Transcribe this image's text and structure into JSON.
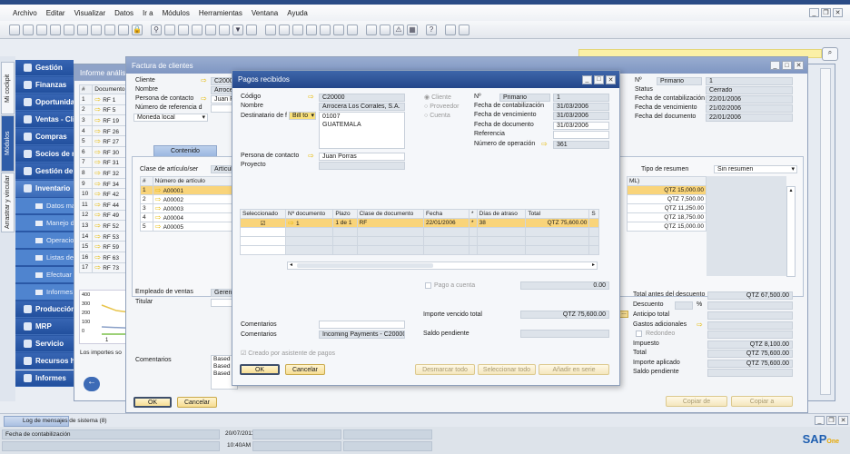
{
  "menu": [
    "Archivo",
    "Editar",
    "Visualizar",
    "Datos",
    "Ir a",
    "Módulos",
    "Herramientas",
    "Ventana",
    "Ayuda"
  ],
  "toolbar_icons": [
    "preview-icon",
    "print-icon",
    "email-icon",
    "sms-icon",
    "fax-icon",
    "excel-icon",
    "word-icon",
    "pdf-icon",
    "launch-icon",
    "lock-icon",
    "find-icon",
    "add-icon",
    "first-record-icon",
    "previous-record-icon",
    "next-record-icon",
    "last-record-icon",
    "filter-icon",
    "sort-icon",
    "base-document-icon",
    "target-document-icon",
    "layout-icon",
    "gross-profit-icon",
    "payment-means-icon",
    "volume-weight-icon",
    "journal-icon",
    "settings-icon",
    "transaction-journal-icon",
    "alert-icon",
    "calendar-icon",
    "help-icon",
    "message-icon",
    "widget-icon"
  ],
  "vtabs": [
    "Mi cockpit",
    "Módulos",
    "Arrastrar y vincular"
  ],
  "modules": [
    "Gestión",
    "Finanzas",
    "Oportunidades",
    "Ventas - Clientes",
    "Compras",
    "Socios de negocios",
    "Gestión de bancos",
    "Inventario"
  ],
  "inventory_sub": [
    "Datos maestros",
    "Manejo de números",
    "Operaciones",
    "Listas de precios",
    "Efectuar recuento",
    "Informes"
  ],
  "modules_after": [
    "Producción",
    "MRP",
    "Servicio",
    "Recursos humanos",
    "Informes"
  ],
  "report": {
    "title": "Informe análisis",
    "col_num": "#",
    "col_doc": "Documento",
    "rows": [
      [
        "1",
        "RF 1"
      ],
      [
        "2",
        "RF 5"
      ],
      [
        "3",
        "RF 19"
      ],
      [
        "4",
        "RF 26"
      ],
      [
        "5",
        "RF 27"
      ],
      [
        "6",
        "RF 30"
      ],
      [
        "7",
        "RF 31"
      ],
      [
        "8",
        "RF 32"
      ],
      [
        "9",
        "RF 34"
      ],
      [
        "10",
        "RF 42"
      ],
      [
        "11",
        "RF 44"
      ],
      [
        "12",
        "RF 49"
      ],
      [
        "13",
        "RF 52"
      ],
      [
        "14",
        "RF 53"
      ],
      [
        "15",
        "RF 59"
      ],
      [
        "16",
        "RF 63"
      ],
      [
        "17",
        "RF 73"
      ]
    ],
    "chart_ticks": [
      "400",
      "300",
      "200",
      "100",
      "0"
    ],
    "chart_x": "1",
    "note": "Los importes so"
  },
  "invoice": {
    "title": "Factura de clientes",
    "cliente_l": "Cliente",
    "cliente": "C20000",
    "nombre_l": "Nombre",
    "nombre": "Arrocera",
    "contacto_l": "Persona de contacto",
    "contacto": "Juan P",
    "ref_l": "Número de referencia d",
    "moneda": "Moneda local",
    "tab": "Contenido",
    "clase_l": "Clase de artículo/ser",
    "clase": "Artículo",
    "col_num": "#",
    "col_item": "Número de artículo",
    "items": [
      [
        "1",
        "A00001"
      ],
      [
        "2",
        "A00002"
      ],
      [
        "3",
        "A00003"
      ],
      [
        "4",
        "A00004"
      ],
      [
        "5",
        "A00005"
      ]
    ],
    "col_total": "ML)",
    "totals": [
      "QTZ 15,000.00",
      "QTZ 7,500.00",
      "QTZ 11,250.00",
      "QTZ 18,750.00",
      "QTZ 15,000.00"
    ],
    "resumen_l": "Tipo de resumen",
    "resumen": "Sin resumen",
    "no_l": "Nº",
    "no_type": "Primario",
    "no": "1",
    "status_l": "Status",
    "status": "Cerrado",
    "fcont_l": "Fecha de contabilización",
    "fcont": "22/01/2006",
    "fvenc_l": "Fecha de vencimiento",
    "fvenc": "21/02/2006",
    "fdoc_l": "Fecha del documento",
    "fdoc": "22/01/2006",
    "empleado_l": "Empleado de ventas",
    "empleado": "Gerente",
    "titular_l": "Titular",
    "comentarios_l": "Comentarios",
    "comentarios": [
      "Based",
      "Based",
      "Based"
    ],
    "tad_l": "Total antes del descuento",
    "tad": "QTZ 67,500.00",
    "desc_l": "Descuento",
    "pct": "%",
    "anticipo_l": "Anticipo total",
    "gastos_l": "Gastos adicionales",
    "redondeo_l": "Redondeo",
    "impuesto_l": "Impuesto",
    "impuesto": "QTZ 8,100.00",
    "total_l": "Total",
    "total": "QTZ 75,600.00",
    "aplicado_l": "Importe aplicado",
    "aplicado": "QTZ 75,600.00",
    "saldo_l": "Saldo pendiente",
    "ok": "OK",
    "cancel": "Cancelar",
    "copy_from": "Copiar de",
    "copy_to": "Copiar a"
  },
  "payment": {
    "title": "Pagos recibidos",
    "codigo_l": "Código",
    "codigo": "C20000",
    "nombre_l": "Nombre",
    "nombre": "Arrocera Los Corrales, S.A.",
    "dest_l": "Destinatario de f",
    "dest": "Bill to",
    "address": [
      "01007",
      "GUATEMALA"
    ],
    "contacto_l": "Persona de contacto",
    "contacto": "Juan Porras",
    "proyecto_l": "Proyecto",
    "radios": [
      "Cliente",
      "Proveedor",
      "Cuenta"
    ],
    "no_l": "Nº",
    "no_type": "Primario",
    "no": "1",
    "fcont_l": "Fecha de contabilización",
    "fcont": "31/03/2006",
    "fvenc_l": "Fecha de vencimiento",
    "fvenc": "31/03/2006",
    "fdoc_l": "Fecha de documento",
    "fdoc": "31/03/2006",
    "ref_l": "Referencia",
    "oper_l": "Número de operación",
    "oper": "361",
    "columns": [
      "Seleccionado",
      "Nº documento",
      "Plazo",
      "Clase de documento",
      "Fecha",
      "*",
      "Días de atraso",
      "Total",
      "S"
    ],
    "row": {
      "doc": "1",
      "plazo": "1 de 1",
      "clase": "RF",
      "fecha": "22/01/2006",
      "star": "*",
      "dias": "38",
      "total": "QTZ 75,600.00"
    },
    "pago_cuenta_l": "Pago a cuenta",
    "pago_cuenta": "0.00",
    "vencido_l": "Importe vencido total",
    "vencido": "QTZ 75,600.00",
    "saldo_l": "Saldo pendiente",
    "coment1_l": "Comentarios",
    "coment2_l": "Comentarios",
    "coment2": "Incoming Payments - C20000",
    "asistente": "Creado por asistente de pagos",
    "ok": "OK",
    "cancel": "Cancelar",
    "deselect": "Desmarcar todo",
    "select": "Seleccionar todo",
    "add_series": "Añadir en serie"
  },
  "log": {
    "tab": "Log de mensajes de sistema (8)"
  },
  "status": {
    "label": "Fecha de contabilización",
    "date": "20/07/2011",
    "time": "10:40AM",
    "logo": "SAP Business One"
  },
  "colors": {
    "accent": "#2a58a6",
    "highlight": "#f9d47a",
    "button": "#f6dc92",
    "search": "#fbf0a6"
  }
}
